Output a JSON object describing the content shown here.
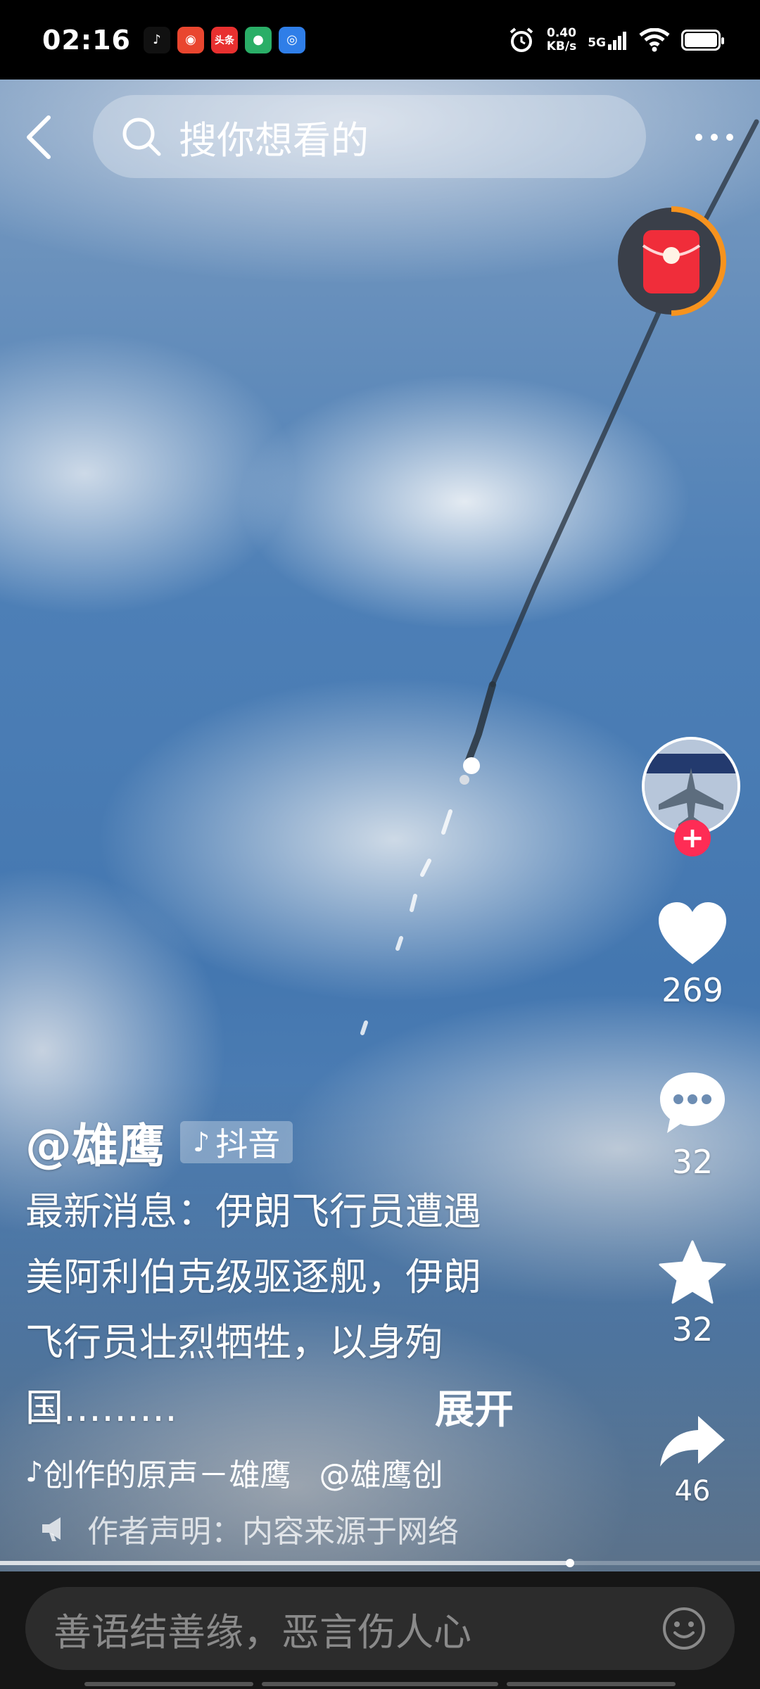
{
  "status_bar": {
    "time": "02:16",
    "apps": [
      {
        "icon": "douyin-icon",
        "label": "♪",
        "color": "#111111"
      },
      {
        "icon": "china-mobile-icon",
        "label": "◉",
        "color": "#e9462f"
      },
      {
        "icon": "toutiao-icon",
        "label": "头条",
        "color": "#e8302f"
      },
      {
        "icon": "wechat-icon",
        "label": "●",
        "color": "#2aae67"
      },
      {
        "icon": "app-icon",
        "label": "◎",
        "color": "#2f7ee8"
      }
    ],
    "net_speed_value": "0.40",
    "net_speed_unit": "KB/s",
    "network": "5G"
  },
  "search": {
    "placeholder": "搜你想看的"
  },
  "author": {
    "name": "@雄鹰",
    "platform_tag": "抖音"
  },
  "description": {
    "lines": [
      "最新消息：伊朗飞行员遭遇",
      "美阿利伯克级驱逐舰，伊朗",
      "飞行员壮烈牺牲，以身殉",
      "国………"
    ],
    "expand_label": "展开"
  },
  "music": {
    "title": "创作的原声－雄鹰",
    "mention": "@雄鹰创"
  },
  "notice": "作者声明：内容来源于网络",
  "actions": {
    "likes": "269",
    "comments": "32",
    "favorites": "32",
    "shares": "46"
  },
  "comment_input": {
    "placeholder": "善语结善缘，恶言伤人心"
  },
  "progress": 0.75,
  "colors": {
    "accent": "#fe2c55",
    "redpack_ring": "#f7931e"
  }
}
